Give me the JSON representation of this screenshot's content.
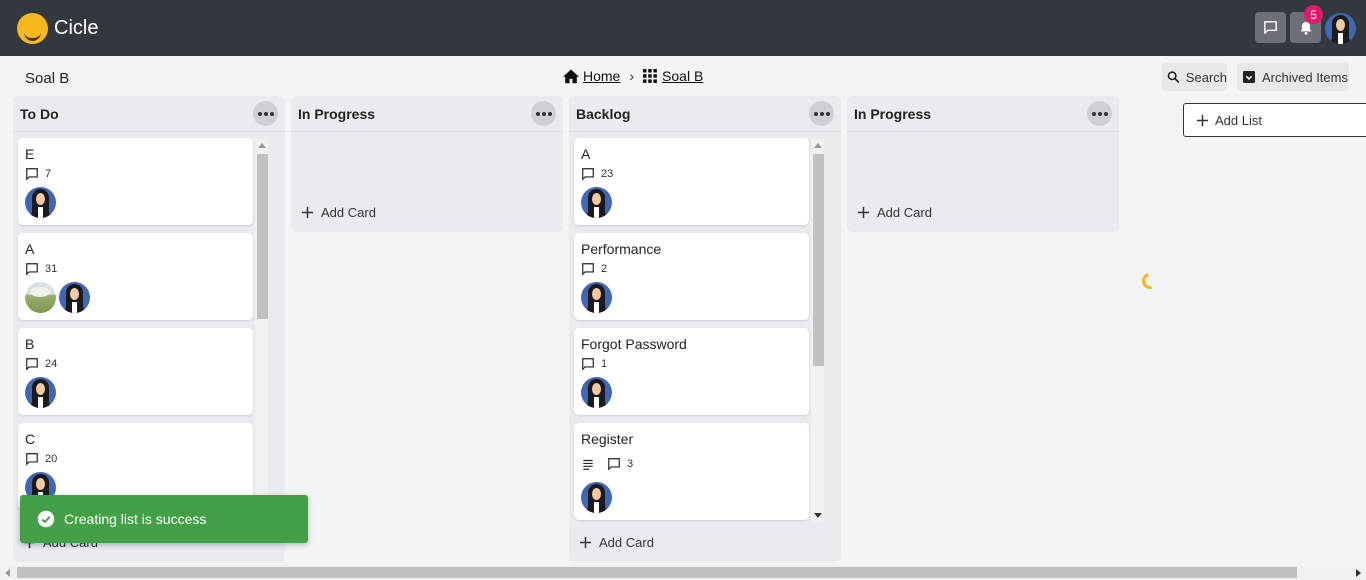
{
  "app": {
    "name": "Cicle",
    "notification_count": "5"
  },
  "board": {
    "title": "Soal B"
  },
  "breadcrumb": {
    "home": "Home",
    "separator": "›",
    "current": "Soal B"
  },
  "toolbar": {
    "search_label": "Search",
    "archived_label": "Archived Items",
    "add_list_label": "Add List"
  },
  "columns": [
    {
      "title": "To Do",
      "add_card_label": "Add Card",
      "cards": [
        {
          "title": "E",
          "comments": "7",
          "avatars": [
            "person"
          ]
        },
        {
          "title": "A",
          "comments": "31",
          "avatars": [
            "landscape",
            "person"
          ]
        },
        {
          "title": "B",
          "comments": "24",
          "avatars": [
            "person"
          ]
        },
        {
          "title": "C",
          "comments": "20",
          "avatars": [
            "person"
          ]
        }
      ]
    },
    {
      "title": "In Progress",
      "add_card_label": "Add Card",
      "cards": []
    },
    {
      "title": "Backlog",
      "add_card_label": "Add Card",
      "cards": [
        {
          "title": "A",
          "comments": "23",
          "avatars": [
            "person"
          ]
        },
        {
          "title": "Performance",
          "comments": "2",
          "avatars": [
            "person"
          ]
        },
        {
          "title": "Forgot Password",
          "comments": "1",
          "avatars": [
            "person"
          ]
        },
        {
          "title": "Register",
          "comments": "3",
          "has_description": true,
          "avatars": [
            "person"
          ]
        }
      ]
    },
    {
      "title": "In Progress",
      "add_card_label": "Add Card",
      "cards": []
    }
  ],
  "toast": {
    "message": "Creating list is success"
  },
  "colors": {
    "topbar": "#33373e",
    "accent": "#f7b81e",
    "badge": "#e2196b",
    "toast": "#43a047"
  },
  "icons": [
    "cicle-logo-icon",
    "chat-icon",
    "bell-icon",
    "home-icon",
    "grid-icon",
    "search-icon",
    "archive-icon",
    "plus-icon",
    "comment-icon",
    "description-icon",
    "more-icon",
    "check-circle-icon",
    "spinner-icon"
  ]
}
